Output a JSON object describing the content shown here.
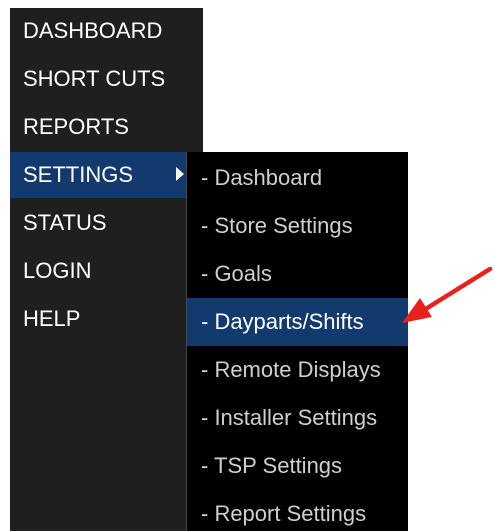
{
  "main_menu": {
    "items": [
      {
        "label": "DASHBOARD"
      },
      {
        "label": "SHORT CUTS"
      },
      {
        "label": "REPORTS"
      },
      {
        "label": "SETTINGS"
      },
      {
        "label": "STATUS"
      },
      {
        "label": "LOGIN"
      },
      {
        "label": "HELP"
      }
    ]
  },
  "settings_submenu": {
    "items": [
      {
        "label": "- Dashboard"
      },
      {
        "label": "- Store Settings"
      },
      {
        "label": "- Goals"
      },
      {
        "label": "- Dayparts/Shifts"
      },
      {
        "label": "- Remote Displays"
      },
      {
        "label": "- Installer Settings"
      },
      {
        "label": "- TSP Settings"
      },
      {
        "label": "- Report Settings"
      }
    ]
  },
  "colors": {
    "menu_background": "#1f1f1f",
    "submenu_background": "#000000",
    "active_highlight": "#133a6e",
    "annotation_arrow": "#e8211c"
  }
}
